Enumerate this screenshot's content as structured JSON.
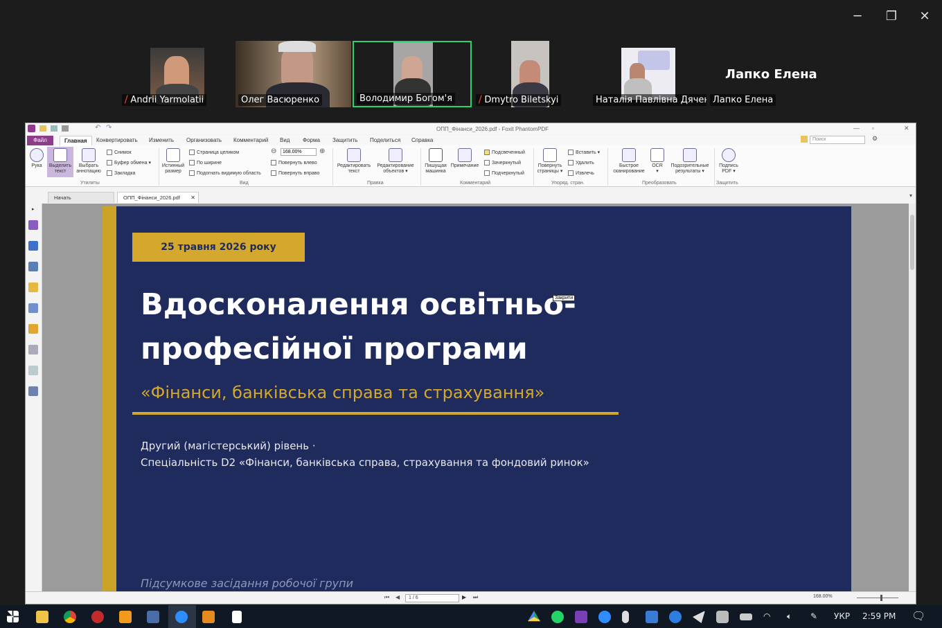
{
  "window_controls": {
    "minimize": "─",
    "restore": "❐",
    "close": "✕"
  },
  "participants": [
    {
      "name": "Andrii Yarmolatii",
      "muted": true
    },
    {
      "name": "Олег Васюренко",
      "muted": false
    },
    {
      "name": "Володимир Богом'я",
      "muted": false,
      "active_speaker": true
    },
    {
      "name": "Dmytro Biletskyi",
      "muted": true
    },
    {
      "name": "Наталія Павлівна Дячен...",
      "muted": false
    },
    {
      "name": "Лапко Елена",
      "muted": false
    }
  ],
  "big_name": "Лапко Елена",
  "app": {
    "title": "ОПП_Фінанси_2026.pdf - Foxit PhantomPDF",
    "menu": [
      "Файл",
      "Главная",
      "Конвертировать",
      "Изменить",
      "Организовать",
      "Комментарий",
      "Вид",
      "Форма",
      "Защитить",
      "Поделиться",
      "Справка"
    ],
    "search_placeholder": "Поиск",
    "ribbon": {
      "hand": "Рука",
      "select_text": "Выделить текст",
      "select_annot": "Выбрать аннотацию",
      "snapshot": "Снимок",
      "clipboard": "Буфер обмена",
      "bookmark": "Закладка",
      "group_utilities": "Утилиты",
      "actual_size": "Истинный размер",
      "full_page": "Страница целиком",
      "fit_width": "По ширине",
      "fit_visible": "Подогнать видимую область",
      "zoom": "168.00%",
      "rotate_left": "Повернуть влево",
      "rotate_right": "Повернуть вправо",
      "group_view": "Вид",
      "edit_text": "Редактировать текст",
      "edit_object": "Редактирование объектов",
      "group_edit": "Правка",
      "typewriter": "Пишущая машинка",
      "note": "Примечание",
      "highlight": "Подсвеченный",
      "strikeout": "Зачеркнутый",
      "underline": "Подчеркнутый",
      "group_comment": "Комментарий",
      "rotate_pages": "Повернуть страницы",
      "insert": "Вставить",
      "delete": "Удалить",
      "extract": "Извлечь",
      "group_pages": "Упоряд. стран.",
      "quick_scan": "Быстрое сканирование",
      "ocr": "OCR",
      "suspect": "Подозрительные результаты",
      "group_convert": "Преобразовать",
      "sign": "Подпись PDF",
      "group_protect": "Защитить"
    },
    "tabs": [
      "Начать",
      "ОПП_Фінанси_2026.pdf"
    ],
    "page_indicator": "1 / 6",
    "zoom_status": "168.00%"
  },
  "slide": {
    "date": "25 травня 2026 року",
    "title_line1": "Вдосконалення освітньо-",
    "title_line2": "професійної програми",
    "subtitle": "«Фінанси, банківська справа та страхування»",
    "level": "Другий (магістерський) рівень ·",
    "specialty": "Спеціальність D2 «Фінанси, банківська справа, страхування та фондовий ринок»",
    "footer": "Підсумкове засідання робочої групи",
    "tooltip": "Закрити"
  },
  "taskbar": {
    "language": "УКР",
    "time": "2:59 PM"
  }
}
